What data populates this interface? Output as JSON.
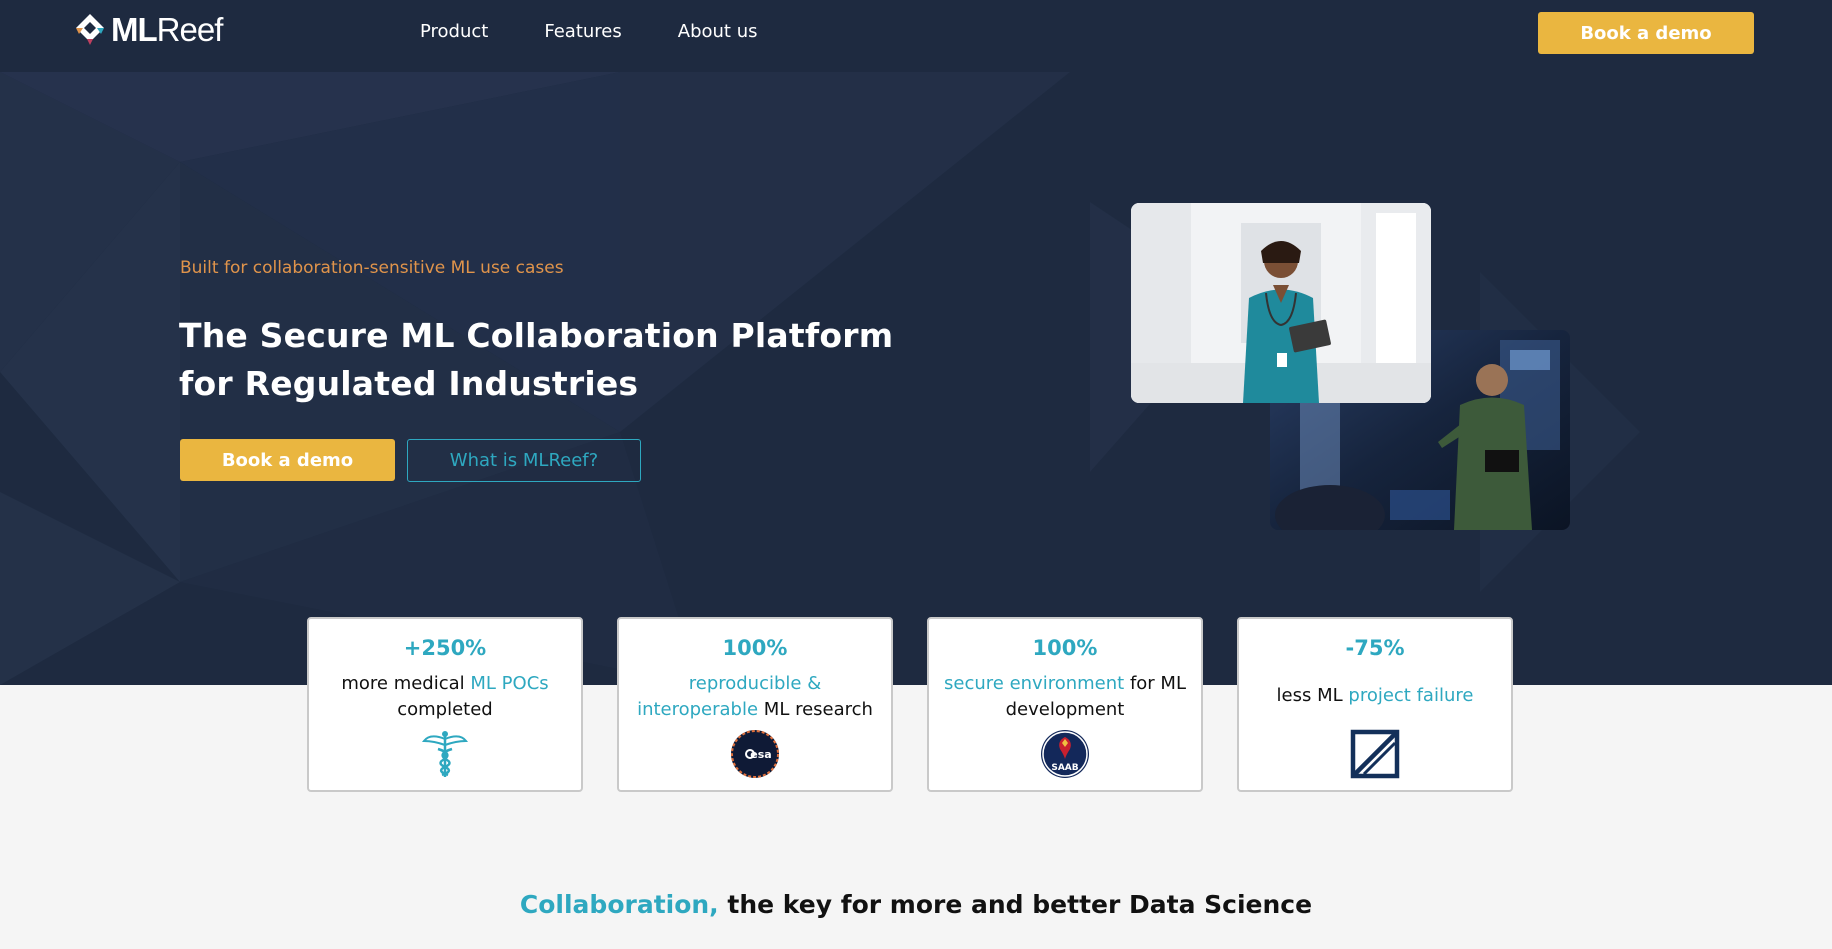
{
  "nav": {
    "logo": {
      "bold": "ML",
      "regular": "Reef"
    },
    "links": [
      "Product",
      "Features",
      "About us"
    ],
    "cta": "Book a demo"
  },
  "hero": {
    "kicker": "Built for collaboration-sensitive ML use cases",
    "title_line1": "The Secure ML Collaboration Platform",
    "title_line2": "for Regulated Industries",
    "primary_button": "Book a demo",
    "secondary_button": "What is MLReef?"
  },
  "stats": [
    {
      "value": "+250%",
      "pre": "more medical ",
      "highlight": "ML POCs",
      "post": "completed",
      "logo": "caduceus-icon"
    },
    {
      "value": "100%",
      "pre": "",
      "highlight": "reproducible & interoperable",
      "post": " ML research",
      "logo": "esa-logo"
    },
    {
      "value": "100%",
      "pre": "",
      "highlight": "secure environment",
      "post": " for ML development",
      "logo": "saab-logo"
    },
    {
      "value": "-75%",
      "pre": "less ML ",
      "highlight": "project failure",
      "post": "",
      "logo": "partner-logo"
    }
  ],
  "section": {
    "highlight": "Collaboration,",
    "rest": " the key for more and better Data Science"
  },
  "colors": {
    "navy": "#1e2a40",
    "accent_yellow": "#eab640",
    "teal": "#2ea8c0",
    "kicker_orange": "#e0944b"
  }
}
